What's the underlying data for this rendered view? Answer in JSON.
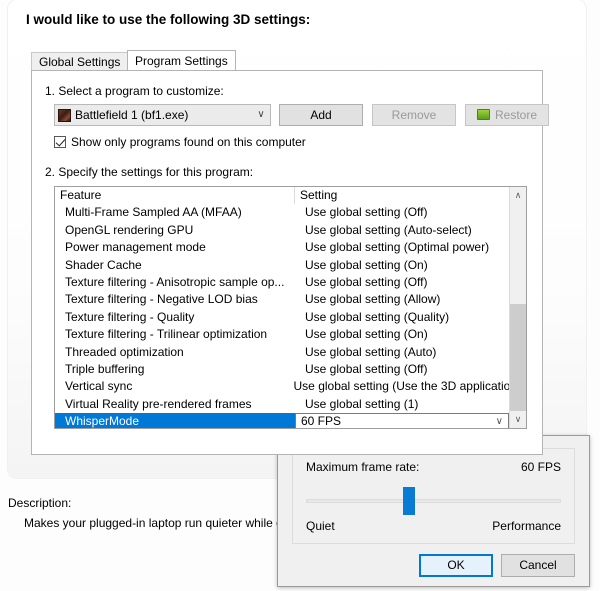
{
  "heading": "I would like to use the following 3D settings:",
  "tabs": [
    {
      "label": "Global Settings",
      "selected": false
    },
    {
      "label": "Program Settings",
      "selected": true
    }
  ],
  "step1": {
    "label": "1. Select a program to customize:",
    "program_value": "Battlefield 1 (bf1.exe)",
    "program_icon": "battlefield-app-icon",
    "dropdown_arrow": "∨",
    "buttons": [
      {
        "name": "add",
        "label": "Add",
        "disabled": false
      },
      {
        "name": "remove",
        "label": "Remove",
        "disabled": true
      },
      {
        "name": "restore",
        "label": "Restore",
        "disabled": true,
        "icon": "restore-green-icon"
      }
    ],
    "checkbox": {
      "label": "Show only programs found on this computer",
      "checked": true
    }
  },
  "step2": {
    "label": "2. Specify the settings for this program:",
    "columns": {
      "feature": "Feature",
      "setting": "Setting"
    },
    "rows": [
      {
        "feature": "Multi-Frame Sampled AA (MFAA)",
        "setting": "Use global setting (Off)",
        "selected": false
      },
      {
        "feature": "OpenGL rendering GPU",
        "setting": "Use global setting (Auto-select)",
        "selected": false
      },
      {
        "feature": "Power management mode",
        "setting": "Use global setting (Optimal power)",
        "selected": false
      },
      {
        "feature": "Shader Cache",
        "setting": "Use global setting (On)",
        "selected": false
      },
      {
        "feature": "Texture filtering - Anisotropic sample op...",
        "setting": "Use global setting (Off)",
        "selected": false
      },
      {
        "feature": "Texture filtering - Negative LOD bias",
        "setting": "Use global setting (Allow)",
        "selected": false
      },
      {
        "feature": "Texture filtering - Quality",
        "setting": "Use global setting (Quality)",
        "selected": false
      },
      {
        "feature": "Texture filtering - Trilinear optimization",
        "setting": "Use global setting (On)",
        "selected": false
      },
      {
        "feature": "Threaded optimization",
        "setting": "Use global setting (Auto)",
        "selected": false
      },
      {
        "feature": "Triple buffering",
        "setting": "Use global setting (Off)",
        "selected": false
      },
      {
        "feature": "Vertical sync",
        "setting": "Use global setting (Use the 3D applicatio...",
        "selected": false
      },
      {
        "feature": "Virtual Reality pre-rendered frames",
        "setting": "Use global setting (1)",
        "selected": false
      },
      {
        "feature": "WhisperMode",
        "setting": "60 FPS",
        "selected": true
      }
    ],
    "scrollbar": {
      "up_arrow": "∧",
      "down_arrow": "∨"
    }
  },
  "description": {
    "title": "Description:",
    "text": "Makes your plugged-in laptop run quieter while g"
  },
  "popup": {
    "frame_rate_label": "Maximum frame rate:",
    "frame_rate_value": "60 FPS",
    "slider_min_label": "Quiet",
    "slider_max_label": "Performance",
    "slider_position_percent": 38,
    "ok_label": "OK",
    "cancel_label": "Cancel"
  },
  "colors": {
    "selection_blue": "#0078d7",
    "slider_blue": "#0a7bd4",
    "panel_gray": "#f0f0f0",
    "button_gray": "#e1e1e1"
  }
}
